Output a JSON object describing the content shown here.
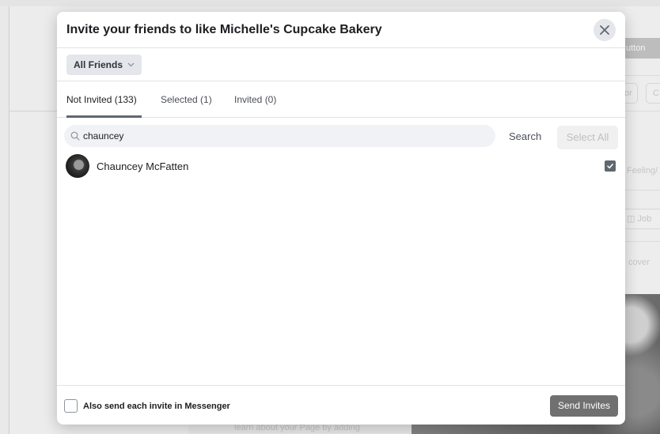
{
  "background": {
    "top_right_button": "utton",
    "chip_partial_1": "or",
    "chip_partial_2": "C",
    "feeling_text": "Feeling/",
    "job_chip": "Job",
    "cover_text": "cover",
    "footnote": "learn about your Page by adding"
  },
  "modal": {
    "title": "Invite your friends to like Michelle's Cupcake Bakery",
    "filter": {
      "label": "All Friends"
    },
    "tabs": [
      {
        "label": "Not Invited (133)",
        "active": true
      },
      {
        "label": "Selected (1)",
        "active": false
      },
      {
        "label": "Invited (0)",
        "active": false
      }
    ],
    "search": {
      "value": "chauncey",
      "button_label": "Search"
    },
    "select_all_label": "Select All",
    "friends": [
      {
        "name": "Chauncey McFatten",
        "selected": true
      }
    ],
    "footer": {
      "messenger_label": "Also send each invite in Messenger",
      "messenger_checked": false,
      "send_label": "Send Invites"
    }
  },
  "colors": {
    "overlay_bg": "#ececec",
    "send_button": "#707070",
    "tab_underline": "#606770"
  }
}
